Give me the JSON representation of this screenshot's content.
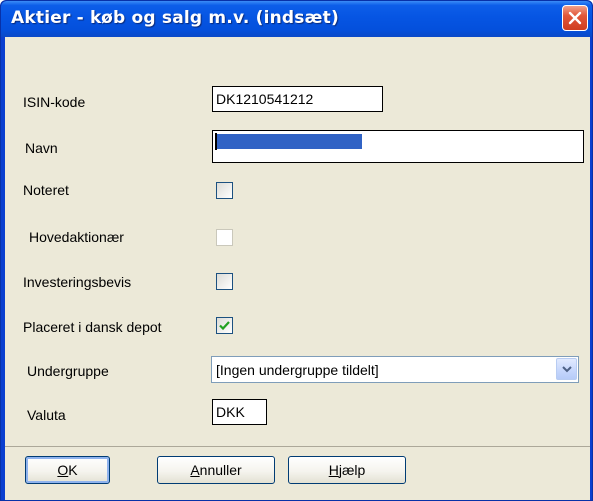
{
  "window": {
    "title": "Aktier - køb og salg m.v. (indsæt)"
  },
  "fields": {
    "isin_label": "ISIN-kode",
    "isin_value": "DK1210541212",
    "navn_label": "Navn",
    "noteret_label": "Noteret",
    "noteret_checked": false,
    "hovedaktionaer_label": "Hovedaktionær",
    "hovedaktionaer_checked": false,
    "hovedaktionaer_enabled": false,
    "investeringsbevis_label": "Investeringsbevis",
    "investeringsbevis_checked": false,
    "placeret_label": "Placeret i dansk depot",
    "placeret_checked": true,
    "undergruppe_label": "Undergruppe",
    "undergruppe_value": "[Ingen undergruppe tildelt]",
    "valuta_label": "Valuta",
    "valuta_value": "DKK"
  },
  "buttons": {
    "ok_mnemonic": "O",
    "ok_rest": "K",
    "annuller_mnemonic": "A",
    "annuller_rest": "nnuller",
    "hjaelp_mnemonic": "H",
    "hjaelp_rest": "jælp"
  },
  "icons": {
    "close": "close-icon",
    "check": "check-icon",
    "dropdown": "chevron-down-icon"
  },
  "colors": {
    "title_bar": "#0655e3",
    "dialog_face": "#ece9d8",
    "checkmark": "#21a121",
    "selection": "#3163c5",
    "close_button": "#e2573a"
  }
}
